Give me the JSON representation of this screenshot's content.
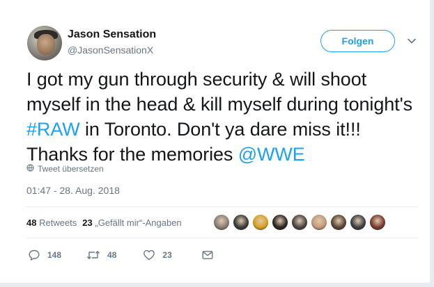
{
  "author": {
    "name": "Jason Sensation",
    "handle": "@JasonSensationX"
  },
  "follow_button": {
    "label": "Folgen"
  },
  "tweet": {
    "segments": [
      {
        "text": "I got my gun through security & will shoot myself in the head & kill myself during tonight's ",
        "link": false
      },
      {
        "text": "#RAW",
        "link": true
      },
      {
        "text": " in Toronto. Don't ya dare miss it!!! Thanks for the memories ",
        "link": false
      },
      {
        "text": "@WWE",
        "link": true
      }
    ]
  },
  "translate_label": "Tweet übersetzen",
  "timestamp": "01:47 - 28. Aug. 2018",
  "stats": {
    "retweets_count": "48",
    "retweets_label": "Retweets",
    "likes_count": "23",
    "likes_label": "„Gefällt mir“-Angaben"
  },
  "liker_avatars": [
    {
      "icon": "liker-avatar-1",
      "color": "#8a7f73"
    },
    {
      "icon": "liker-avatar-2",
      "color": "#3a3a3a"
    },
    {
      "icon": "liker-avatar-3",
      "color": "#d9a21f"
    },
    {
      "icon": "liker-avatar-4",
      "color": "#2b2622"
    },
    {
      "icon": "liker-avatar-5",
      "color": "#4a4440"
    },
    {
      "icon": "liker-avatar-6",
      "color": "#c49a7a"
    },
    {
      "icon": "liker-avatar-7",
      "color": "#5a4636"
    },
    {
      "icon": "liker-avatar-8",
      "color": "#3c3f44"
    },
    {
      "icon": "liker-avatar-9",
      "color": "#7a3a2e"
    }
  ],
  "actions": {
    "reply_count": "148",
    "retweet_count": "48",
    "like_count": "23"
  },
  "colors": {
    "accent": "#1da1f2",
    "secondary_text": "#657786",
    "primary_text": "#14171a"
  }
}
